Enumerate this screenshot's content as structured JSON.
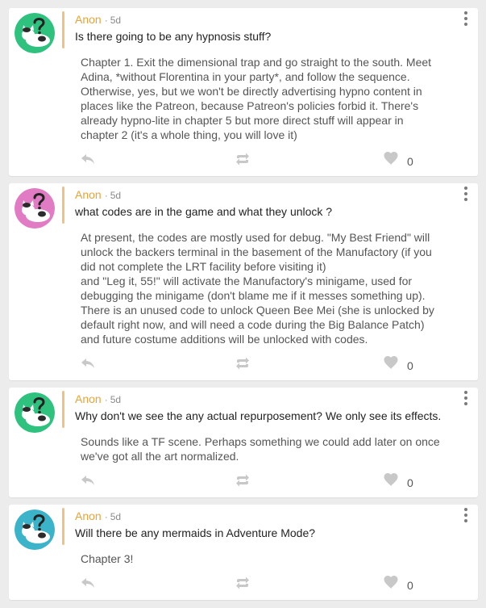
{
  "colors": {
    "background": "#ececec",
    "card": "#ffffff",
    "author": "#e8a33a",
    "quote_bar": "#f1c27d",
    "icon_gray": "#c8c8c8"
  },
  "posts": [
    {
      "avatar_bg": "#2ec27e",
      "author": "Anon",
      "separator": "·",
      "time": "5d",
      "question": "Is there going to be any hypnosis stuff?",
      "answer_lines": [
        "Chapter 1. Exit the dimensional trap and go straight to the south. Meet",
        "Adina, *without Florentina in your party*, and follow the sequence.",
        "Otherwise, yes, but we won't be directly advertising hypno content in",
        "places like the Patreon, because Patreon's policies forbid it. There's",
        "already hypno-lite in chapter 5 but more direct stuff will appear in",
        "chapter 2 (it's a whole thing, you will love it)"
      ],
      "likes": "0",
      "icons": [
        "reply-icon",
        "share-icon",
        "heart-icon",
        "more-icon"
      ]
    },
    {
      "avatar_bg": "#e07bc4",
      "author": "Anon",
      "separator": "·",
      "time": "5d",
      "question": "what codes are in the game and what they unlock ?",
      "answer_lines": [
        "At present, the codes are mostly used for debug. \"My Best Friend\" will",
        "unlock the backers terminal in the basement of the Manufactory (if you",
        "did not complete the LRT facility before visiting it)",
        "and \"Leg it, 55!\" will activate the Manufactory's minigame, used for",
        "debugging the minigame (don't blame me if it messes something up).",
        "There is an unused code to unlock Queen Bee Mei (she is unlocked by",
        "default right now, and will need a code during the Big Balance Patch)",
        "and future costume additions will be unlocked with codes."
      ],
      "likes": "0",
      "icons": [
        "reply-icon",
        "share-icon",
        "heart-icon",
        "more-icon"
      ]
    },
    {
      "avatar_bg": "#2ec27e",
      "author": "Anon",
      "separator": "·",
      "time": "5d",
      "question": "Why don't we see the any actual repurposement? We only see its effects.",
      "answer_lines": [
        "Sounds like a TF scene. Perhaps something we could add later on once",
        "we've got all the art normalized."
      ],
      "likes": "0",
      "icons": [
        "reply-icon",
        "share-icon",
        "heart-icon",
        "more-icon"
      ]
    },
    {
      "avatar_bg": "#3bb3c8",
      "author": "Anon",
      "separator": "·",
      "time": "5d",
      "question": "Will there be any mermaids in Adventure Mode?",
      "answer_lines": [
        "Chapter 3!"
      ],
      "likes": "0",
      "icons": [
        "reply-icon",
        "share-icon",
        "heart-icon",
        "more-icon"
      ]
    }
  ]
}
